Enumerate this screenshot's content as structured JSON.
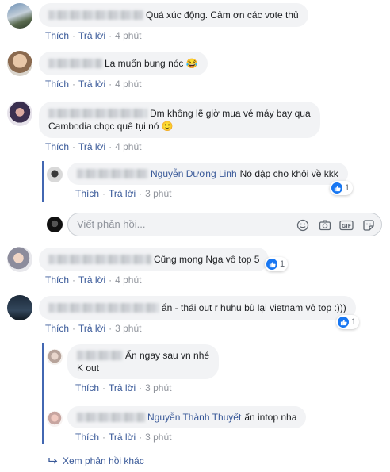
{
  "comments": [
    {
      "text": "Quá xúc động. Cảm ơn các vote thủ",
      "like_label": "Thích",
      "reply_label": "Trả lời",
      "time": "4 phút"
    },
    {
      "text": "La muốn bung nóc 😂",
      "like_label": "Thích",
      "reply_label": "Trả lời",
      "time": "4 phút"
    },
    {
      "text_line1": "Đm không lẽ giờ mua vé máy bay qua",
      "text_line2": "Cambodia chọc quê tụi nó 🙂",
      "like_label": "Thích",
      "reply_label": "Trả lời",
      "time": "4 phút"
    },
    {
      "text": "Cũng mong Nga vô top 5",
      "like_label": "Thích",
      "reply_label": "Trả lời",
      "time": "4 phút",
      "reaction_count": "1"
    },
    {
      "text": "ẩn - thái out r huhu bù lại vietnam vô top :)))",
      "like_label": "Thích",
      "reply_label": "Trả lời",
      "time": "3 phút",
      "reaction_count": "1"
    }
  ],
  "replies": [
    {
      "tagged_name": "Nguyễn Dương Linh",
      "text": "Nó đập cho khỏi về kkk",
      "like_label": "Thích",
      "reply_label": "Trả lời",
      "time": "3 phút",
      "reaction_count": "1"
    },
    {
      "text_line1": "Ẩn ngay sau vn nhé",
      "text_line2": "K out",
      "like_label": "Thích",
      "reply_label": "Trả lời",
      "time": "3 phút"
    },
    {
      "tagged_name": "Nguyễn Thành Thuyết",
      "text": "ẩn intop nha",
      "like_label": "Thích",
      "reply_label": "Trả lời",
      "time": "3 phút"
    }
  ],
  "reply_box": {
    "placeholder": "Viết phản hồi..."
  },
  "more_replies": {
    "label": "Xem phản hồi khác"
  },
  "colors": {
    "link": "#385898",
    "bubble": "#f2f3f5",
    "like_blue": "#1877f2",
    "thread_line": "#4267b2",
    "meta": "#90949c"
  },
  "icons": [
    "emoji-icon",
    "camera-icon",
    "gif-icon",
    "sticker-icon",
    "like-icon",
    "reply-arrow-icon"
  ]
}
